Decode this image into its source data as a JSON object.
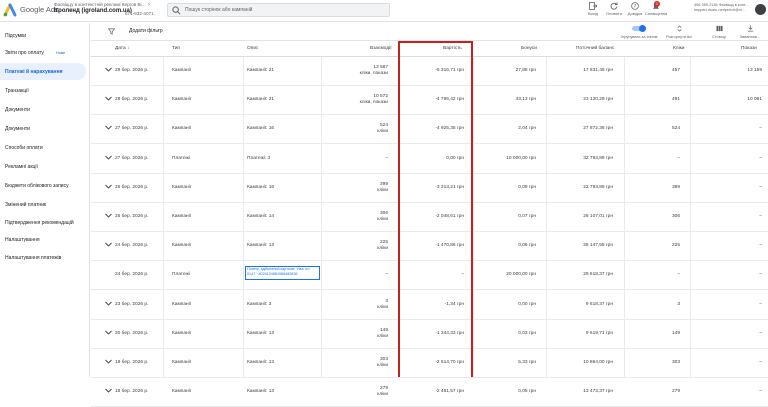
{
  "header": {
    "brand": "Google Ads",
    "account_line1": "Фасвіццу в контекстній рекламі Кергов Bi…",
    "account_name": "Ігроленд (igroland.com.ua)",
    "account_id": "671-932-4071",
    "search_placeholder": "Пошук сторінок або кампаній",
    "buttons": [
      {
        "label": "Вихід",
        "icon": "logout-icon"
      },
      {
        "label": "Оновити",
        "icon": "refresh-icon"
      },
      {
        "label": "Довідка",
        "icon": "help-icon"
      },
      {
        "label": "Сповіщення",
        "icon": "bell-icon",
        "badge": "1"
      }
    ],
    "user_line1": "406-359-2136 Фасвіщц в конт...",
    "user_line2": "hepperi-rfcalu-neriperich@m..."
  },
  "sidebar": {
    "items": [
      {
        "label": "Підсумки",
        "active": false
      },
      {
        "label": "Звіти про оплату",
        "badge": "Нове",
        "active": false
      },
      {
        "label": "Платежі й нарахування",
        "active": true
      },
      {
        "label": "Транзакції",
        "active": false
      },
      {
        "label": "Документи",
        "active": false
      },
      {
        "label": "Документи",
        "active": false
      },
      {
        "label": "Способи оплати",
        "active": false
      },
      {
        "label": "Рекламні акції",
        "active": false
      },
      {
        "label": "Бюджети облікового запису",
        "active": false
      },
      {
        "label": "Змінений платник",
        "active": false
      },
      {
        "label": "Підтвердження рекомендацій",
        "active": false
      },
      {
        "label": "Налаштування",
        "active": false
      },
      {
        "label": "Налаштування платежів",
        "active": false
      }
    ]
  },
  "toolbar": {
    "add_filter": "Додати фільтр",
    "actions": [
      {
        "label": "Згрупувати за типом",
        "icon": "toggle-icon"
      },
      {
        "label": "Розгорнути всі",
        "icon": "expand-icon"
      },
      {
        "label": "Стовпці",
        "icon": "columns-icon"
      },
      {
        "label": "Завантаж...",
        "icon": "download-icon"
      }
    ]
  },
  "table": {
    "columns": [
      "Дата",
      "Тип",
      "Опис",
      "Взаємодії",
      "Вартість",
      "Бонуси",
      "Поточний баланс",
      "Кліки",
      "Покази"
    ],
    "rows": [
      {
        "date": "29 бер. 2026 р.",
        "type": "Кампанії",
        "desc": "Кампанії: 21",
        "inter1": "13 587",
        "inter2": "кліки, покази",
        "cost": "-5 316,71 грн",
        "bonus": "27,88 грн",
        "balance": "17 831,46 грн",
        "clicks": "457",
        "impr": "13 159",
        "expand": true
      },
      {
        "date": "28 бер. 2026 р.",
        "type": "Кампанії",
        "desc": "Кампанії: 21",
        "inter1": "10 572",
        "inter2": "кліки, покази",
        "cost": "-4 795,42 грн",
        "bonus": "43,13 грн",
        "balance": "23 120,29 грн",
        "clicks": "491",
        "impr": "10 081",
        "expand": true
      },
      {
        "date": "27 бер. 2026 р.",
        "type": "Кампанії",
        "desc": "Кампанії: 16",
        "inter1": "524",
        "inter2": "кліки",
        "cost": "-4 925,35 грн",
        "bonus": "2,04 грн",
        "balance": "27 872,38 грн",
        "clicks": "524",
        "impr": "–",
        "expand": true
      },
      {
        "date": "27 бер. 2026 р.",
        "type": "Платежі",
        "desc": "Платежі: 3",
        "inter1": "–",
        "inter2": "",
        "cost": "0,00 грн",
        "bonus": "10 000,00 грн",
        "balance": "32 793,89 грн",
        "clicks": "–",
        "impr": "–",
        "expand": true
      },
      {
        "date": "26 бер. 2026 р.",
        "type": "Кампанії",
        "desc": "Кампанії: 16",
        "inter1": "399",
        "inter2": "кліки",
        "cost": "-3 313,21 грн",
        "bonus": "0,09 грн",
        "balance": "22 793,89 грн",
        "clicks": "399",
        "impr": "–",
        "expand": true
      },
      {
        "date": "25 бер. 2026 р.",
        "type": "Кампанії",
        "desc": "Кампанії: 14",
        "inter1": "306",
        "inter2": "кліки",
        "cost": "-2 048,61 грн",
        "bonus": "0,07 грн",
        "balance": "26 107,01 грн",
        "clicks": "306",
        "impr": "–",
        "expand": true
      },
      {
        "date": "24 бер. 2026 р.",
        "type": "Кампанії",
        "desc": "Кампанії: 13",
        "inter1": "225",
        "inter2": "кліки",
        "cost": "-1 470,86 грн",
        "bonus": "0,06 грн",
        "balance": "28 147,55 грн",
        "clicks": "225",
        "impr": "–",
        "expand": true
      },
      {
        "date": "24 бер. 2026 р.",
        "type": "Платежі",
        "desc": "Платіж, здійснений карткою: Visa •••• 0147 · #024124881986482836",
        "inter1": "–",
        "inter2": "",
        "cost": "–",
        "bonus": "20 000,00 грн",
        "balance": "29 618,37 грн",
        "clicks": "–",
        "impr": "–",
        "expand": false,
        "link": true
      },
      {
        "date": "23 бер. 2026 р.",
        "type": "Кампанії",
        "desc": "Кампанії: 3",
        "inter1": "3",
        "inter2": "кліки",
        "cost": "-1,34 грн",
        "bonus": "0,00 грн",
        "balance": "9 618,37 грн",
        "clicks": "3",
        "impr": "–",
        "expand": true
      },
      {
        "date": "20 бер. 2026 р.",
        "type": "Кампанії",
        "desc": "Кампанії: 13",
        "inter1": "149",
        "inter2": "кліки",
        "cost": "-1 344,33 грн",
        "bonus": "0,03 грн",
        "balance": "9 619,71 грн",
        "clicks": "149",
        "impr": "–",
        "expand": true
      },
      {
        "date": "19 бер. 2026 р.",
        "type": "Кампанії",
        "desc": "Кампанії: 13",
        "inter1": "303",
        "inter2": "кліки",
        "cost": "-2 614,70 грн",
        "bonus": "5,33 грн",
        "balance": "10 864,00 грн",
        "clicks": "303",
        "impr": "–",
        "expand": true
      },
      {
        "date": "18 бер. 2026 р.",
        "type": "Кампанії",
        "desc": "Кампанії: 13",
        "inter1": "279",
        "inter2": "кліки",
        "cost": "-2 461,57 грн",
        "bonus": "0,05 грн",
        "balance": "13 473,37 грн",
        "clicks": "279",
        "impr": "–",
        "expand": true
      }
    ]
  },
  "colors": {
    "accent": "#1a73e8",
    "highlight_border": "#c5221f",
    "active_bg": "#e8f0fe"
  }
}
